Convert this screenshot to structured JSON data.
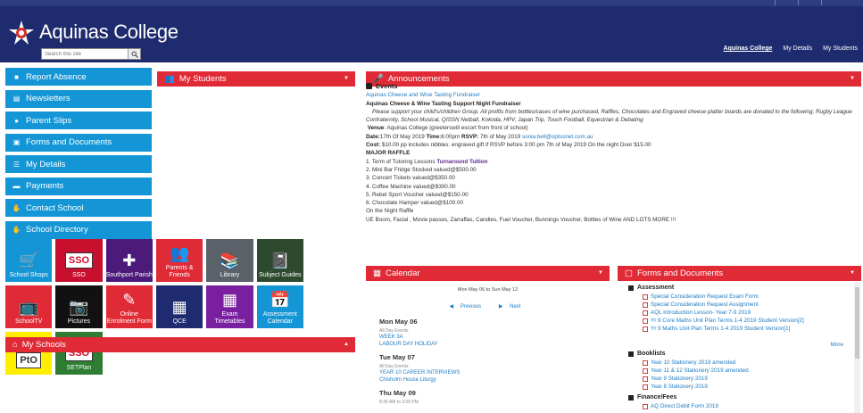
{
  "header": {
    "brand": "Aquinas College",
    "search_placeholder": "Search this site",
    "nav": [
      "Aquinas College",
      "My Details",
      "My Students"
    ]
  },
  "sidebar": {
    "items": [
      {
        "label": "Report Absence",
        "icon": "briefcase-icon"
      },
      {
        "label": "Newsletters",
        "icon": "newspaper-icon"
      },
      {
        "label": "Parent Slips",
        "icon": "users-icon"
      },
      {
        "label": "Forms and Documents",
        "icon": "document-icon"
      },
      {
        "label": "My Details",
        "icon": "form-icon"
      },
      {
        "label": "Payments",
        "icon": "credit-card-icon"
      },
      {
        "label": "Contact School",
        "icon": "handshake-icon"
      },
      {
        "label": "School Directory",
        "icon": "handshake-icon"
      }
    ]
  },
  "tiles": [
    {
      "label": "School Shops",
      "color": "#1496d6",
      "icon": "cart-icon",
      "glyph": "🛒"
    },
    {
      "label": "SSO",
      "color": "#c8102e",
      "icon": "sso-icon",
      "glyph": "SSO"
    },
    {
      "label": "Southport Parish",
      "color": "#4b1a7a",
      "icon": "cross-icon",
      "glyph": "✚"
    },
    {
      "label": "Parents & Friends",
      "color": "#e02b36",
      "icon": "people-icon",
      "glyph": "👥"
    },
    {
      "label": "Library",
      "color": "#5a6168",
      "icon": "books-icon",
      "glyph": "📚"
    },
    {
      "label": "Subject Guides",
      "color": "#2d4a2e",
      "icon": "notebook-icon",
      "glyph": "📓"
    },
    {
      "label": "SchoolTV",
      "color": "#e02b36",
      "icon": "tv-icon",
      "glyph": "📺"
    },
    {
      "label": "Pictures",
      "color": "#111111",
      "icon": "camera-icon",
      "glyph": "📷"
    },
    {
      "label": "Online Enrolment Form",
      "color": "#e02b36",
      "icon": "pencil-icon",
      "glyph": "✎"
    },
    {
      "label": "QCE",
      "color": "#1e2b6e",
      "icon": "qce-icon",
      "glyph": "▦"
    },
    {
      "label": "Exam Timetables",
      "color": "#7a1fa0",
      "icon": "calculator-icon",
      "glyph": "▦"
    },
    {
      "label": "Assessment Calendar",
      "color": "#1496d6",
      "icon": "calendar-icon",
      "glyph": "📅"
    },
    {
      "label": "",
      "color": "#ffee00",
      "icon": "pto-icon",
      "glyph": "PtO"
    },
    {
      "label": "SETPlan",
      "color": "#2e7d32",
      "icon": "sso-set-icon",
      "glyph": "SSO"
    }
  ],
  "panels": {
    "my_students": "My Students",
    "my_schools": "My Schools",
    "announcements": "Announcements",
    "calendar": "Calendar",
    "forms": "Forms and Documents"
  },
  "announcements": {
    "section": "Events",
    "link": "Aquinas Cheese and Wine Tasting Fundraiser",
    "heading": "Aquinas Cheese & Wine Tasting Support Night Fundraiser",
    "body": "Please support your child's/children Group. All profits from bottles/cases of wine purchased, Raffles, Chocolates and Engraved cheese platter boards are donated to the following; Rugby League Confraternity, School Musical, QISSN Netball, Kokoda, HPV, Japan Trip, Touch Football, Equestrian & Debating",
    "venue_label": "Venue",
    "venue": "Aquinas College (greeterswill escort from front of school)",
    "date_label": "Date:",
    "date": "17th Of May 2019",
    "time_label": "Time:",
    "time": "6:00pm",
    "rsvp_label": "RSVP:",
    "rsvp": "7th of May 2019",
    "email": "sonia.bell@optusnet.com.au",
    "cost_label": "Cost:",
    "cost": "$10.00 pp includes nibbles: engraved gift if RSVP before 3:00 pm 7th of May 2019 On the night Door $15.00",
    "raffle_heading": "MAJOR RAFFLE",
    "raffle": [
      "1. Term of Tutoring Lessons",
      "2. Mini Bar Fridge Stocked valued@$500.00",
      "3. Concert Tickets valued@$350.00",
      "4. Coffee Machine valued@$300.00",
      "5. Rebel Sport Voucher valued@$150.00",
      "6. Chocolate Hamper valued@$100.00"
    ],
    "raffle_highlight": "Turnaround Tuition",
    "night_raffle": "On the Night Raffle",
    "night_items": "UE Boom, Facial , Movie passes, Zarraffas, Candles, Fuel Voucher, Bunnings Voucher, Bottles of Wine  AND LOTS MORE !!!"
  },
  "calendar": {
    "range": "Mon May 06 to Sun May 12",
    "prev": "Previous",
    "next": "Next",
    "days": [
      {
        "day": "Mon May 06",
        "sub": "All Day Events",
        "events": [
          "WEEK 3A",
          "LABOUR DAY HOLIDAY"
        ]
      },
      {
        "day": "Tue May 07",
        "sub": "All Day Events",
        "events": [
          "YEAR 10 CAREER INTERVIEWS",
          "Chisholm House Liturgy"
        ]
      },
      {
        "day": "Thu May 09",
        "sub": "8:30 AM to 3:00 PM",
        "events": []
      }
    ]
  },
  "forms": {
    "sections": [
      {
        "title": "Assessment",
        "items": [
          "Special Consideration Request Exam Form",
          "Special Consideration Request Assignment",
          "AQL Introduction Lesson- Year 7-9 2019",
          "Yr 9 Core Maths Unit Plan Terms 1-4 2019 Student Version[2]",
          "Yr 9 Maths Unit Plan Terms 1-4 2019 Student Version[1]"
        ]
      },
      {
        "title": "Booklists",
        "items": [
          "Year 10 Stationery 2019 amended",
          "Year 11 & 12 Stationery 2019 amended",
          "Year 9 Stationery 2019",
          "Year 8 Stationery 2019"
        ]
      },
      {
        "title": "Finance/Fees",
        "items": [
          "AQ Direct Debit Form 2019"
        ]
      }
    ],
    "more": "More"
  }
}
